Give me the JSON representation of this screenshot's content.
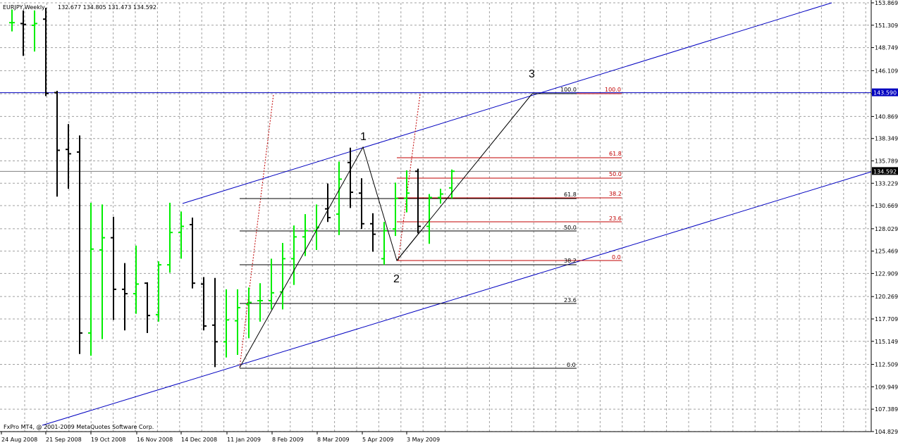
{
  "header": {
    "symbol": "EURJPY,Weekly",
    "ohlc": "132.677 134.805 131.473 134.592"
  },
  "copyright": "FxPro MT4, @ 2001-2009 MetaQuotes Software Corp.",
  "colors": {
    "background": "#ffffff",
    "grid": "#a0a0a0",
    "bull": "#00ee00",
    "bear": "#000000",
    "channel": "#0000c0",
    "fib_red": "#c00000",
    "fib_black": "#000000"
  },
  "chart_data": {
    "type": "ohlc",
    "title": "EURJPY,Weekly",
    "ylim": [
      104.82,
      153.87
    ],
    "y_ticks": [
      "153.869",
      "151.309",
      "148.749",
      "146.109",
      "143.470",
      "140.869",
      "138.349",
      "135.789",
      "133.229",
      "130.669",
      "128.029",
      "125.469",
      "122.909",
      "120.269",
      "117.709",
      "115.149",
      "112.509",
      "109.949",
      "107.389",
      "104.829"
    ],
    "x_labels": [
      "24 Aug 2008",
      "21 Sep 2008",
      "19 Oct 2008",
      "16 Nov 2008",
      "14 Dec 2008",
      "11 Jan 2009",
      "8 Feb 2009",
      "8 Mar 2009",
      "5 Apr 2009",
      "3 May 2009"
    ],
    "price_tags": [
      {
        "value": "143.590",
        "style": "channel"
      },
      {
        "value": "134.592",
        "style": "current"
      }
    ],
    "horizontal_line_values": [
      143.59,
      134.592
    ],
    "bars": [
      {
        "o": 151.6,
        "h": 153.1,
        "l": 150.6,
        "c": 151.6
      },
      {
        "o": 151.5,
        "h": 153.0,
        "l": 147.8,
        "c": 151.4
      },
      {
        "o": 151.3,
        "h": 153.0,
        "l": 148.3,
        "c": 151.5
      },
      {
        "o": 152.0,
        "h": 153.3,
        "l": 143.2,
        "c": 143.5
      },
      {
        "o": 143.6,
        "h": 143.8,
        "l": 131.7,
        "c": 137.0
      },
      {
        "o": 137.1,
        "h": 140.0,
        "l": 132.6,
        "c": 136.6
      },
      {
        "o": 136.8,
        "h": 138.7,
        "l": 113.7,
        "c": 116.1
      },
      {
        "o": 116.1,
        "h": 131.0,
        "l": 113.5,
        "c": 125.7
      },
      {
        "o": 125.6,
        "h": 130.8,
        "l": 115.4,
        "c": 127.0
      },
      {
        "o": 127.0,
        "h": 129.4,
        "l": 117.6,
        "c": 121.1
      },
      {
        "o": 121.1,
        "h": 124.1,
        "l": 116.4,
        "c": 120.6
      },
      {
        "o": 120.6,
        "h": 126.1,
        "l": 118.3,
        "c": 121.7
      },
      {
        "o": 121.8,
        "h": 121.9,
        "l": 116.1,
        "c": 118.1
      },
      {
        "o": 118.2,
        "h": 124.3,
        "l": 117.4,
        "c": 123.9
      },
      {
        "o": 123.9,
        "h": 131.0,
        "l": 123.0,
        "c": 127.6
      },
      {
        "o": 127.6,
        "h": 130.0,
        "l": 124.6,
        "c": 128.3
      },
      {
        "o": 128.5,
        "h": 129.3,
        "l": 121.2,
        "c": 121.8
      },
      {
        "o": 121.7,
        "h": 122.5,
        "l": 116.4,
        "c": 116.9
      },
      {
        "o": 117.0,
        "h": 122.4,
        "l": 112.2,
        "c": 115.1
      },
      {
        "o": 115.1,
        "h": 121.1,
        "l": 113.3,
        "c": 117.6
      },
      {
        "o": 117.5,
        "h": 121.1,
        "l": 113.6,
        "c": 119.0
      },
      {
        "o": 119.4,
        "h": 121.3,
        "l": 115.5,
        "c": 119.6
      },
      {
        "o": 119.8,
        "h": 121.8,
        "l": 117.4,
        "c": 119.8
      },
      {
        "o": 119.8,
        "h": 124.6,
        "l": 118.8,
        "c": 120.7
      },
      {
        "o": 120.8,
        "h": 126.4,
        "l": 118.8,
        "c": 124.6
      },
      {
        "o": 124.6,
        "h": 128.4,
        "l": 121.6,
        "c": 127.1
      },
      {
        "o": 127.1,
        "h": 129.7,
        "l": 124.9,
        "c": 127.8
      },
      {
        "o": 127.8,
        "h": 130.8,
        "l": 125.6,
        "c": 128.2
      },
      {
        "o": 130.3,
        "h": 133.2,
        "l": 128.8,
        "c": 129.3
      },
      {
        "o": 129.7,
        "h": 135.7,
        "l": 127.3,
        "c": 133.7
      },
      {
        "o": 135.6,
        "h": 137.3,
        "l": 130.4,
        "c": 132.2
      },
      {
        "o": 132.1,
        "h": 133.8,
        "l": 128.0,
        "c": 128.6
      },
      {
        "o": 128.6,
        "h": 129.8,
        "l": 125.4,
        "c": 127.4
      },
      {
        "o": 124.6,
        "h": 128.8,
        "l": 123.9,
        "c": 127.8
      },
      {
        "o": 128.0,
        "h": 133.3,
        "l": 127.2,
        "c": 131.5
      },
      {
        "o": 131.5,
        "h": 134.7,
        "l": 129.9,
        "c": 132.1
      },
      {
        "o": 134.6,
        "h": 134.9,
        "l": 127.5,
        "c": 128.3
      },
      {
        "o": 128.3,
        "h": 132.0,
        "l": 126.3,
        "c": 131.6
      },
      {
        "o": 131.6,
        "h": 132.6,
        "l": 130.9,
        "c": 132.0
      },
      {
        "o": 132.7,
        "h": 134.8,
        "l": 131.5,
        "c": 134.6
      }
    ],
    "annotations": [
      "1",
      "2",
      "3"
    ],
    "fib_left_labels": [
      "0.0",
      "23.6",
      "38.2",
      "50.0",
      "61.8",
      "100.0"
    ],
    "fib_right_labels": [
      "0.0",
      "23.6",
      "38.2",
      "50.0",
      "61.8",
      "100.0"
    ]
  }
}
